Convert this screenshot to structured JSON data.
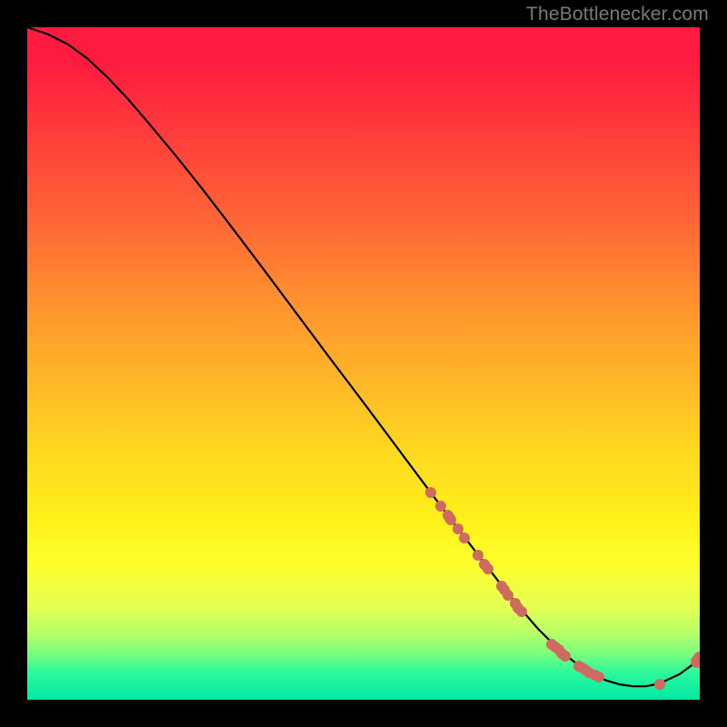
{
  "attribution": "TheBottlenecker.com",
  "chart_data": {
    "type": "line",
    "title": "",
    "xlabel": "",
    "ylabel": "",
    "xlim": [
      0,
      100
    ],
    "ylim": [
      0,
      100
    ],
    "series": [
      {
        "name": "curve",
        "x": [
          0,
          3,
          6,
          9,
          12,
          15,
          18,
          22,
          26,
          30,
          35,
          40,
          45,
          50,
          55,
          60,
          65,
          68,
          70,
          72,
          74,
          76,
          78,
          80,
          82,
          84,
          86,
          88,
          90,
          92,
          94,
          97,
          100
        ],
        "y": [
          100,
          99.0,
          97.5,
          95.3,
          92.5,
          89.3,
          85.8,
          81.0,
          76.0,
          70.8,
          64.2,
          57.5,
          50.8,
          44.2,
          37.5,
          30.8,
          24.2,
          20.3,
          17.7,
          15.2,
          12.8,
          10.5,
          8.5,
          6.7,
          5.1,
          3.8,
          2.9,
          2.3,
          2.0,
          2.0,
          2.4,
          3.8,
          6.0
        ]
      }
    ],
    "scatter_points": [
      {
        "x": 60.0,
        "y": 30.8
      },
      {
        "x": 61.5,
        "y": 28.8
      },
      {
        "x": 62.5,
        "y": 27.4
      },
      {
        "x": 62.8,
        "y": 27.0
      },
      {
        "x": 63.0,
        "y": 26.7
      },
      {
        "x": 64.0,
        "y": 25.4
      },
      {
        "x": 65.0,
        "y": 24.1
      },
      {
        "x": 67.0,
        "y": 21.5
      },
      {
        "x": 68.0,
        "y": 20.2
      },
      {
        "x": 68.5,
        "y": 19.5
      },
      {
        "x": 70.5,
        "y": 16.9
      },
      {
        "x": 71.0,
        "y": 16.3
      },
      {
        "x": 71.5,
        "y": 15.6
      },
      {
        "x": 72.5,
        "y": 14.3
      },
      {
        "x": 73.0,
        "y": 13.7
      },
      {
        "x": 73.5,
        "y": 13.1
      },
      {
        "x": 78.0,
        "y": 8.3
      },
      {
        "x": 78.5,
        "y": 7.8
      },
      {
        "x": 79.0,
        "y": 7.4
      },
      {
        "x": 79.5,
        "y": 6.9
      },
      {
        "x": 80.0,
        "y": 6.5
      },
      {
        "x": 82.0,
        "y": 5.0
      },
      {
        "x": 82.5,
        "y": 4.7
      },
      {
        "x": 83.0,
        "y": 4.4
      },
      {
        "x": 83.5,
        "y": 4.1
      },
      {
        "x": 84.5,
        "y": 3.6
      },
      {
        "x": 85.0,
        "y": 3.4
      },
      {
        "x": 94.0,
        "y": 2.3
      },
      {
        "x": 99.6,
        "y": 5.7
      },
      {
        "x": 100.0,
        "y": 6.2
      }
    ]
  }
}
